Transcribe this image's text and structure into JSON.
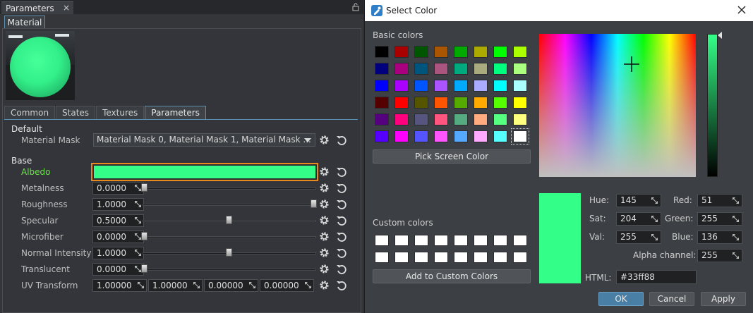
{
  "left_panel": {
    "window_tab": "Parameters",
    "material_tab": "Material",
    "tabs": [
      "Common",
      "States",
      "Textures",
      "Parameters"
    ],
    "sections": {
      "default": "Default",
      "base": "Base"
    },
    "material_mask": {
      "label": "Material Mask",
      "value": "Material Mask 0, Material Mask 1, Material Mask ..."
    },
    "albedo": {
      "label": "Albedo",
      "color": "#33ff88"
    },
    "params": [
      {
        "label": "Metalness",
        "value": "0.0000",
        "slider": 0.0
      },
      {
        "label": "Roughness",
        "value": "1.0000",
        "slider": 1.0
      },
      {
        "label": "Specular",
        "value": "0.5000",
        "slider": 0.5
      },
      {
        "label": "Microfiber",
        "value": "0.0000",
        "slider": 0.0
      },
      {
        "label": "Normal Intensity",
        "value": "1.0000",
        "slider": 0.5
      },
      {
        "label": "Translucent",
        "value": "0.0000",
        "slider": 0.0
      }
    ],
    "uv_transform": {
      "label": "UV Transform",
      "values": [
        "1.00000",
        "1.00000",
        "0.00000",
        "0.00000"
      ]
    }
  },
  "dialog": {
    "title": "Select Color",
    "basic_colors_label": "Basic colors",
    "basic_colors": [
      "#000000",
      "#aa0000",
      "#005500",
      "#aa5500",
      "#00aa00",
      "#aaaa00",
      "#00ff00",
      "#aaff00",
      "#00007f",
      "#aa007f",
      "#00557f",
      "#aa557f",
      "#00aa7f",
      "#aaaa7f",
      "#00ff7f",
      "#aaff7f",
      "#0000ff",
      "#aa00ff",
      "#0055ff",
      "#aa55ff",
      "#00aaff",
      "#aaaaff",
      "#00ffff",
      "#aaffff",
      "#550000",
      "#ff0000",
      "#555500",
      "#ff5500",
      "#55aa00",
      "#ffaa00",
      "#55ff00",
      "#ffff00",
      "#55007f",
      "#ff007f",
      "#55557f",
      "#ff557f",
      "#55aa7f",
      "#ffaa7f",
      "#55ff7f",
      "#ffff7f",
      "#5500ff",
      "#ff00ff",
      "#5555ff",
      "#ff55ff",
      "#55aaff",
      "#ffaaff",
      "#55ffff",
      "#ffffff"
    ],
    "pick_screen_label": "Pick Screen Color",
    "custom_colors_label": "Custom colors",
    "add_custom_label": "Add to Custom Colors",
    "current_color": "#33ff88",
    "fields": {
      "hue": {
        "label": "Hue:",
        "value": "145"
      },
      "sat": {
        "label": "Sat:",
        "value": "204"
      },
      "val": {
        "label": "Val:",
        "value": "255"
      },
      "red": {
        "label": "Red:",
        "value": "51"
      },
      "green": {
        "label": "Green:",
        "value": "255"
      },
      "blue": {
        "label": "Blue:",
        "value": "136"
      },
      "alpha": {
        "label": "Alpha channel:",
        "value": "255"
      }
    },
    "html": {
      "label": "HTML:",
      "value": "#33ff88"
    },
    "ok_label": "OK",
    "cancel_label": "Cancel",
    "apply_label": "Apply"
  }
}
